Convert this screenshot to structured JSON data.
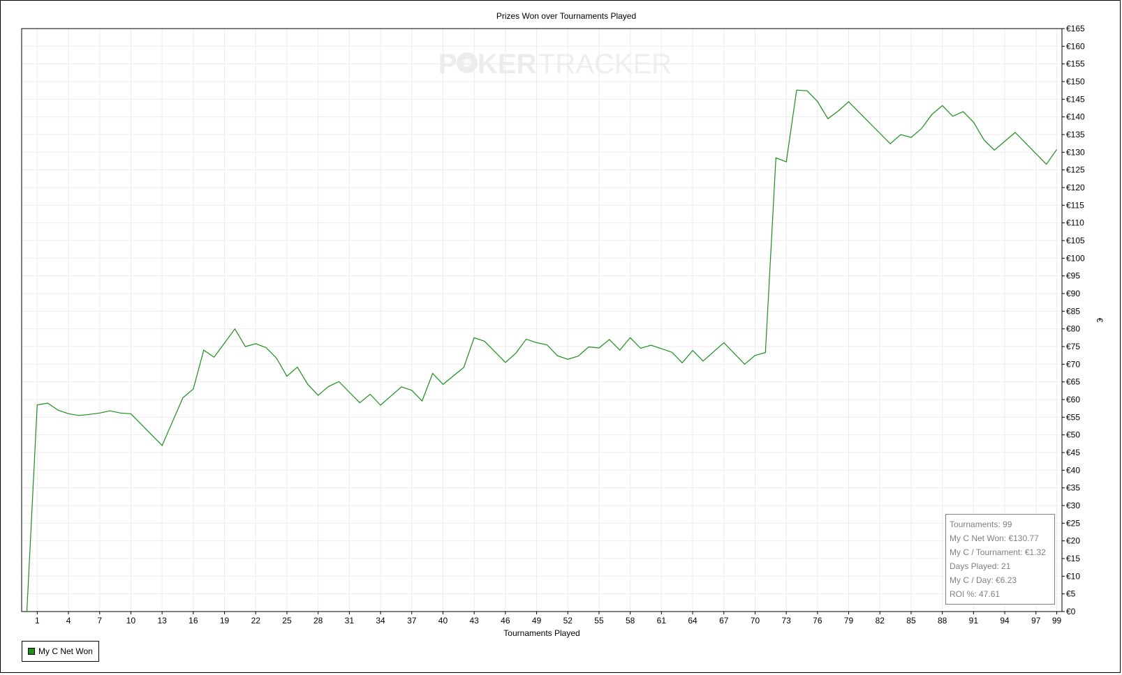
{
  "window": {
    "background": "#ffffff"
  },
  "watermark": {
    "text_a": "P",
    "text_b": "KER",
    "text_c": "TRACKER"
  },
  "stats": {
    "tournaments": "Tournaments: 99",
    "net_won": "My C Net Won: €130.77",
    "per_tournament": "My C / Tournament: €1.32",
    "days_played": "Days Played: 21",
    "per_day": "My C / Day: €6.23",
    "roi": "ROI %: 47.61"
  },
  "legend": {
    "label": "My C Net Won",
    "color": "#1a8f1a"
  },
  "chart_data": {
    "type": "line",
    "title": "Prizes Won over Tournaments Played",
    "xlabel": "Tournaments Played",
    "ylabel": "€",
    "xlim": [
      -0.5,
      99.5
    ],
    "ylim": [
      0,
      165
    ],
    "x_ticks": [
      1,
      4,
      7,
      10,
      13,
      16,
      19,
      22,
      25,
      28,
      31,
      34,
      37,
      40,
      43,
      46,
      49,
      52,
      55,
      58,
      61,
      64,
      67,
      70,
      73,
      76,
      79,
      82,
      85,
      88,
      91,
      94,
      97,
      99
    ],
    "y_ticks": [
      0,
      5,
      10,
      15,
      20,
      25,
      30,
      35,
      40,
      45,
      50,
      55,
      60,
      65,
      70,
      75,
      80,
      85,
      90,
      95,
      100,
      105,
      110,
      115,
      120,
      125,
      130,
      135,
      140,
      145,
      150,
      155,
      160,
      165
    ],
    "y_tick_labels": [
      "€0",
      "€5",
      "€10",
      "€15",
      "€20",
      "€25",
      "€30",
      "€35",
      "€40",
      "€45",
      "€50",
      "€55",
      "€60",
      "€65",
      "€70",
      "€75",
      "€80",
      "€85",
      "€90",
      "€95",
      "€100",
      "€105",
      "€110",
      "€115",
      "€120",
      "€125",
      "€130",
      "€135",
      "€140",
      "€145",
      "€150",
      "€155",
      "€160",
      "€165"
    ],
    "grid": true,
    "legend_position": "bottom-left",
    "series": [
      {
        "name": "My C Net Won",
        "color": "#1a8f1a",
        "x": [
          0,
          1,
          2,
          3,
          4,
          5,
          6,
          7,
          8,
          9,
          10,
          13,
          15,
          16,
          17,
          18,
          19,
          20,
          21,
          22,
          23,
          24,
          25,
          26,
          27,
          28,
          29,
          30,
          32,
          33,
          34,
          36,
          37,
          38,
          39,
          40,
          42,
          43,
          44,
          46,
          47,
          48,
          49,
          50,
          51,
          52,
          53,
          54,
          55,
          56,
          57,
          58,
          59,
          60,
          62,
          63,
          64,
          65,
          67,
          69,
          70,
          71,
          72,
          73,
          74,
          75,
          76,
          77,
          78,
          79,
          83,
          84,
          85,
          86,
          87,
          88,
          89,
          90,
          91,
          92,
          93,
          95,
          98,
          99
        ],
        "values": [
          0,
          58.5,
          59,
          57,
          56,
          55.5,
          55.8,
          56.2,
          56.8,
          56.2,
          56,
          47,
          60.5,
          63,
          74,
          72,
          76,
          80,
          75,
          75.8,
          74.7,
          71.7,
          66.6,
          69.2,
          64.3,
          61.2,
          63.7,
          65.1,
          59.1,
          61.5,
          58.4,
          63.6,
          62.6,
          59.6,
          67.4,
          64.3,
          69.1,
          77.5,
          76.5,
          70.5,
          73.1,
          77.1,
          76.1,
          75.5,
          72.4,
          71.4,
          72.3,
          74.9,
          74.6,
          77,
          74,
          77.5,
          74.5,
          75.4,
          73.4,
          70.4,
          73.9,
          70.9,
          76.1,
          70,
          72.5,
          73.3,
          128.4,
          127.3,
          147.6,
          147.4,
          144.4,
          139.5,
          141.7,
          144.3,
          132.4,
          135,
          134.2,
          136.7,
          140.7,
          143.2,
          140.2,
          141.5,
          138.5,
          133.5,
          130.6,
          135.6,
          126.6,
          130.8
        ]
      }
    ]
  }
}
